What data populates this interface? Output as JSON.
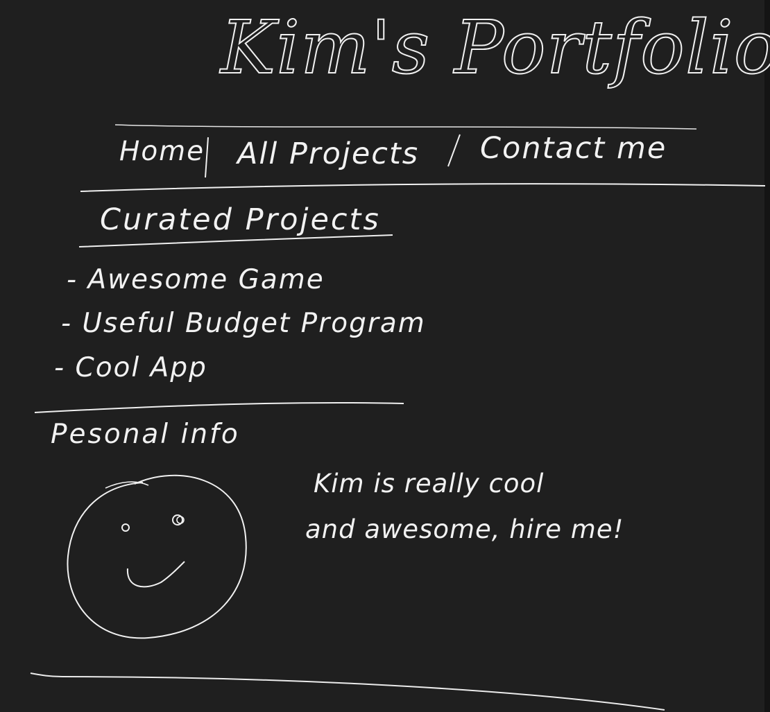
{
  "header": {
    "title": "Kim's Portfolio"
  },
  "nav": {
    "home": "Home",
    "divider_1": "|",
    "all_projects": "All Projects",
    "divider_2": "/",
    "contact": "Contact me"
  },
  "curated": {
    "heading": "Curated Projects",
    "items": [
      "- Awesome Game",
      "- Useful Budget Program",
      "- Cool App"
    ]
  },
  "personal": {
    "heading": "Pesonal info",
    "avatar": "smiley-face",
    "about_line_1": "Kim is really cool",
    "about_line_2": "and awesome, hire me!"
  },
  "colors": {
    "background": "#1f1f1f",
    "ink": "#f2f2f2"
  }
}
